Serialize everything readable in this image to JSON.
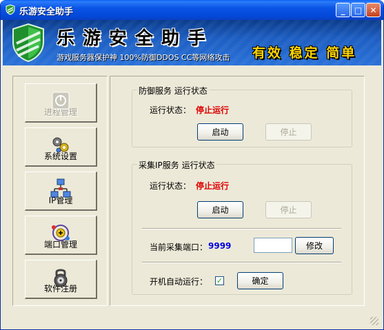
{
  "window": {
    "title": "乐游安全助手",
    "controls": {
      "minimize": "_",
      "maximize": "□",
      "close": "✕"
    }
  },
  "banner": {
    "title": "乐游安全助手",
    "subtitle": "游戏服务器保护神 100%防御DDOS CC等网络攻击",
    "slogan": "有效 稳定 简单"
  },
  "nav": [
    {
      "label": "进程管理",
      "icon": "power-icon",
      "disabled": true
    },
    {
      "label": "系统设置",
      "icon": "gears-icon",
      "disabled": false
    },
    {
      "label": "IP管理",
      "icon": "network-icon",
      "disabled": false
    },
    {
      "label": "端口管理",
      "icon": "port-icon",
      "disabled": false
    },
    {
      "label": "软件注册",
      "icon": "lock-icon",
      "disabled": false
    }
  ],
  "defense": {
    "title": "防御服务 运行状态",
    "status_label": "运行状态：",
    "status_value": "停止运行",
    "start_label": "启动",
    "stop_label": "停止"
  },
  "collect": {
    "title": "采集IP服务 运行状态",
    "status_label": "运行状态：",
    "status_value": "停止运行",
    "start_label": "启动",
    "stop_label": "停止",
    "port_label": "当前采集端口：",
    "port_value": "9999",
    "port_input_value": "",
    "modify_label": "修改",
    "autostart_label": "开机自动运行：",
    "autostart_checked": "✓",
    "confirm_label": "确定"
  },
  "colors": {
    "status_stopped": "#e00000",
    "port_value": "#0000e0",
    "titlebar": "#0a54e6"
  }
}
